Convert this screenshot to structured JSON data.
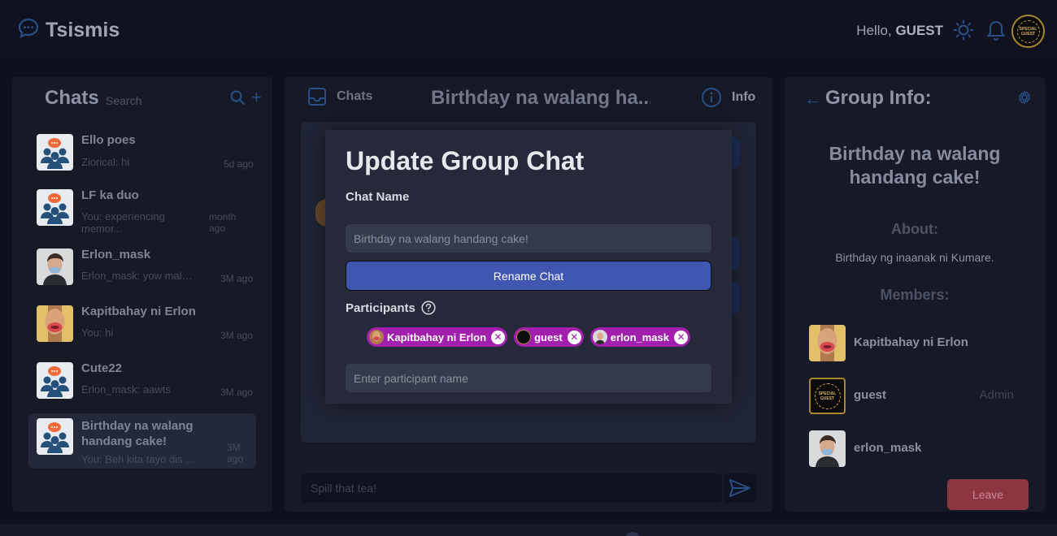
{
  "app": {
    "name": "Tsismis"
  },
  "header": {
    "greeting": "Hello,",
    "username": "GUEST",
    "avatar_seal_text": "SPECIAL GUEST"
  },
  "sidebar": {
    "title": "Chats",
    "search_placeholder": "Search",
    "chats": [
      {
        "name": "Ello poes",
        "preview": "Ziorical: hi",
        "time": "5d ago"
      },
      {
        "name": "LF ka duo",
        "preview": "You: experiencing memor...",
        "time": "month ago"
      },
      {
        "name": "Erlon_mask",
        "preview": "Erlon_mask: yow malala",
        "time": "3M ago"
      },
      {
        "name": "Kapitbahay ni Erlon",
        "preview": "You: hi",
        "time": "3M ago"
      },
      {
        "name": "Cute22",
        "preview": "Erlon_mask: aawts",
        "time": "3M ago"
      },
      {
        "name": "Birthday na walang handang cake!",
        "preview": "You: Beh kita tayo dis ...",
        "time": "3M ago"
      }
    ]
  },
  "main": {
    "tab_chats": "Chats",
    "title": "Birthday na walang ha...",
    "tab_info": "Info",
    "compose_placeholder": "Spill that tea!"
  },
  "modal": {
    "title": "Update Group Chat",
    "chat_name_label": "Chat Name",
    "chat_name_placeholder": "Birthday na walang handang cake!",
    "rename_button": "Rename Chat",
    "participants_label": "Participants",
    "participants": [
      "Kapitbahay ni Erlon",
      "guest",
      "erlon_mask"
    ],
    "participant_placeholder": "Enter participant name"
  },
  "info": {
    "title": "Group Info:",
    "chat_name": "Birthday na walang handang cake!",
    "about_heading": "About:",
    "about_text": "Birthday ng inaanak ni Kumare.",
    "members_heading": "Members:",
    "members": [
      {
        "name": "Kapitbahay ni Erlon",
        "role": ""
      },
      {
        "name": "guest",
        "role": "Admin"
      },
      {
        "name": "erlon_mask",
        "role": ""
      }
    ],
    "leave_button": "Leave"
  },
  "colors": {
    "accent": "#3f57b0",
    "chip": "#a21fae",
    "leave": "#8c3641",
    "background": "#0e111d",
    "panel": "#161a27"
  }
}
